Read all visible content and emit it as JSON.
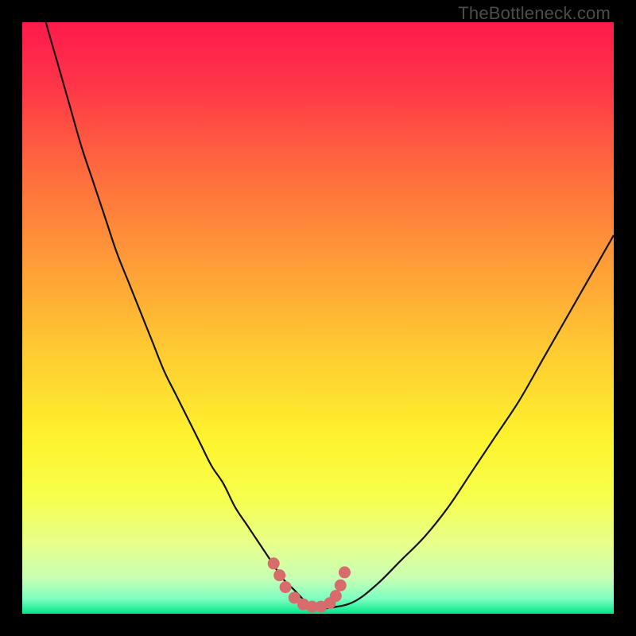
{
  "watermark": "TheBottleneck.com",
  "gradient_stops": [
    {
      "offset": 0.0,
      "color": "#ff1a4d"
    },
    {
      "offset": 0.1,
      "color": "#ff3348"
    },
    {
      "offset": 0.25,
      "color": "#ff6a3e"
    },
    {
      "offset": 0.4,
      "color": "#ff9a38"
    },
    {
      "offset": 0.55,
      "color": "#ffc932"
    },
    {
      "offset": 0.7,
      "color": "#fff22d"
    },
    {
      "offset": 0.8,
      "color": "#f7ff4a"
    },
    {
      "offset": 0.88,
      "color": "#e8ff8a"
    },
    {
      "offset": 0.94,
      "color": "#c8ffb4"
    },
    {
      "offset": 0.975,
      "color": "#7dffc0"
    },
    {
      "offset": 1.0,
      "color": "#00e688"
    }
  ],
  "curve_color": "#141414",
  "marker_color": "#d86b6b",
  "chart_data": {
    "type": "line",
    "title": "",
    "xlabel": "",
    "ylabel": "",
    "xlim": [
      0,
      100
    ],
    "ylim": [
      0,
      100
    ],
    "grid": false,
    "series": [
      {
        "name": "bottleneck-curve",
        "x": [
          0,
          2,
          4,
          6,
          8,
          10,
          12,
          14,
          16,
          18,
          20,
          22,
          24,
          26,
          28,
          30,
          32,
          34,
          36,
          38,
          40,
          42,
          44,
          46,
          48,
          50,
          52,
          56,
          60,
          64,
          68,
          72,
          76,
          80,
          84,
          88,
          92,
          96,
          100
        ],
        "y": [
          116,
          108,
          100,
          93,
          86,
          79,
          73,
          67,
          61,
          56,
          51,
          46,
          41,
          37,
          33,
          29,
          25,
          22,
          18,
          15,
          12,
          9,
          6,
          4,
          2,
          1,
          1,
          2,
          5,
          9,
          13,
          18,
          24,
          30,
          36,
          43,
          50,
          57,
          64
        ]
      }
    ],
    "markers": {
      "name": "optimal-range-markers",
      "x": [
        42.5,
        43.5,
        44.5,
        46.0,
        47.5,
        49.0,
        50.5,
        52.0,
        53.0,
        53.8,
        54.5
      ],
      "y": [
        8.5,
        6.5,
        4.5,
        2.7,
        1.6,
        1.2,
        1.2,
        1.8,
        3.0,
        4.8,
        7.0
      ]
    },
    "annotations": []
  }
}
